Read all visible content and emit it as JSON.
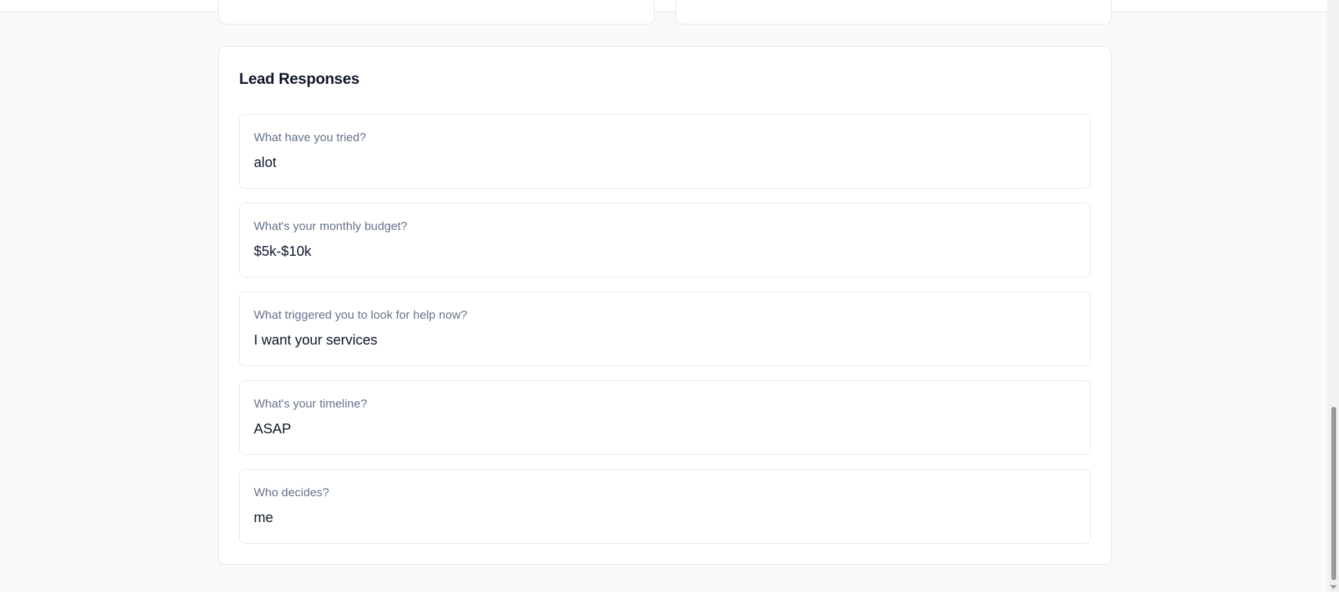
{
  "lead_responses": {
    "title": "Lead Responses",
    "items": [
      {
        "question": "What have you tried?",
        "answer": "alot"
      },
      {
        "question": "What's your monthly budget?",
        "answer": "$5k-$10k"
      },
      {
        "question": "What triggered you to look for help now?",
        "answer": "I want your services"
      },
      {
        "question": "What's your timeline?",
        "answer": "ASAP"
      },
      {
        "question": "Who decides?",
        "answer": "me"
      }
    ]
  }
}
